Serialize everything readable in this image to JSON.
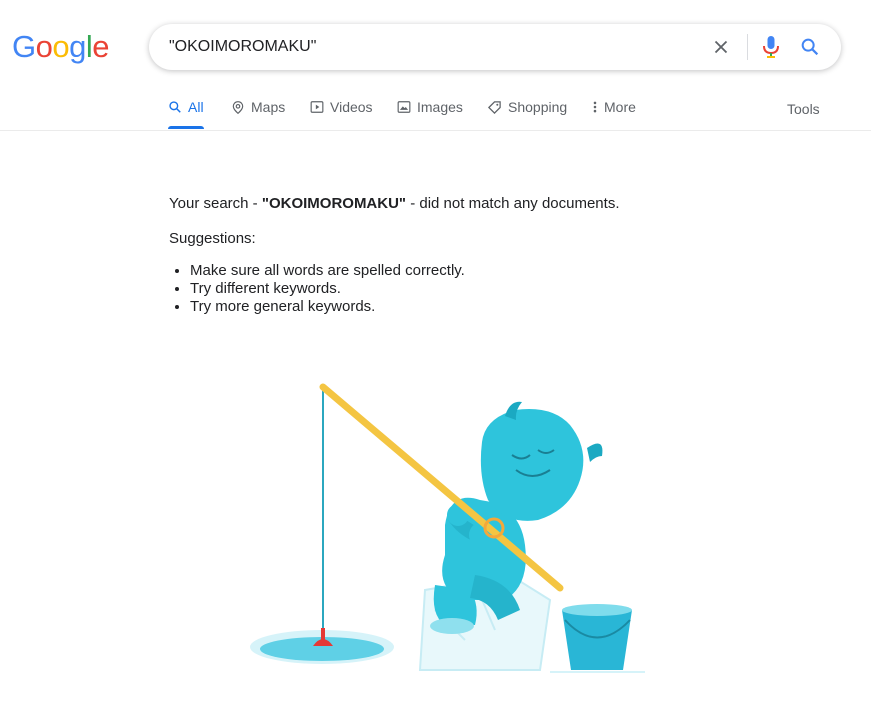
{
  "logo": {
    "letters": [
      "G",
      "o",
      "o",
      "g",
      "l",
      "e"
    ],
    "colors": [
      "#4285f4",
      "#ea4335",
      "#fbbc05",
      "#4285f4",
      "#34a853",
      "#ea4335"
    ]
  },
  "search": {
    "query": "\"OKOIMOROMAKU\""
  },
  "tabs": [
    {
      "label": "All",
      "icon": "search-icon",
      "active": true
    },
    {
      "label": "Maps",
      "icon": "map-pin-icon"
    },
    {
      "label": "Videos",
      "icon": "video-icon"
    },
    {
      "label": "Images",
      "icon": "image-icon"
    },
    {
      "label": "Shopping",
      "icon": "tag-icon"
    },
    {
      "label": "More",
      "icon": "more-vertical-icon"
    }
  ],
  "tools_label": "Tools",
  "result": {
    "prefix": "Your search - ",
    "query": "\"OKOIMOROMAKU\"",
    "suffix": " - did not match any documents.",
    "suggestions_title": "Suggestions:",
    "suggestions": [
      "Make sure all words are spelled correctly.",
      "Try different keywords.",
      "Try more general keywords."
    ]
  },
  "colors": {
    "accent": "#1a73e8",
    "yeti": "#2ec4dc",
    "rod": "#f4c542",
    "bucket": "#29b6d6",
    "bobber": "#e53935"
  }
}
